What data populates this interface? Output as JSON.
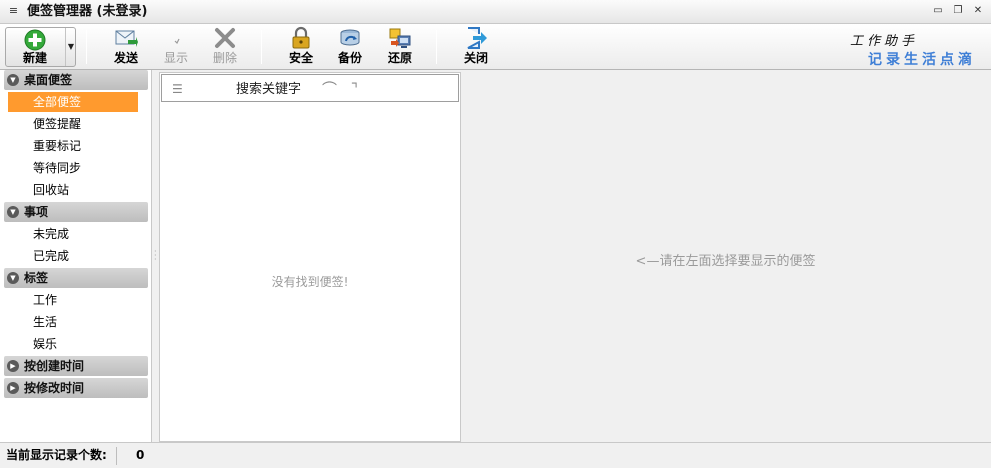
{
  "window": {
    "title": "便签管理器 (未登录)",
    "buttons": {
      "minimize": "▭",
      "restore": "❐",
      "close": "✕"
    }
  },
  "toolbar": {
    "new_label": "新建",
    "send_label": "发送",
    "show_label": "显示",
    "delete_label": "删除",
    "security_label": "安全",
    "backup_label": "备份",
    "restore_label": "还原",
    "close_label": "关闭"
  },
  "brand": {
    "line1": "工作助手",
    "line2": "记录生活点滴"
  },
  "sidebar": {
    "groups": [
      {
        "label": "桌面便签",
        "items": [
          "全部便签",
          "便签提醒",
          "重要标记",
          "等待同步",
          "回收站"
        ]
      },
      {
        "label": "事项",
        "items": [
          "未完成",
          "已完成"
        ]
      },
      {
        "label": "标签",
        "items": [
          "工作",
          "生活",
          "娱乐"
        ]
      },
      {
        "label": "按创建时间",
        "items": []
      },
      {
        "label": "按修改时间",
        "items": []
      }
    ],
    "selected": "全部便签"
  },
  "search": {
    "placeholder": "搜索关键字"
  },
  "list": {
    "empty_text": "没有找到便签!"
  },
  "detail": {
    "hint": "<—请在左面选择要显示的便签"
  },
  "status": {
    "label": "当前显示记录个数:",
    "count": "0"
  },
  "colors": {
    "selected_bg": "#ff9a2e",
    "brand_blue": "#3f7fd6",
    "new_green": "#34a93a"
  }
}
